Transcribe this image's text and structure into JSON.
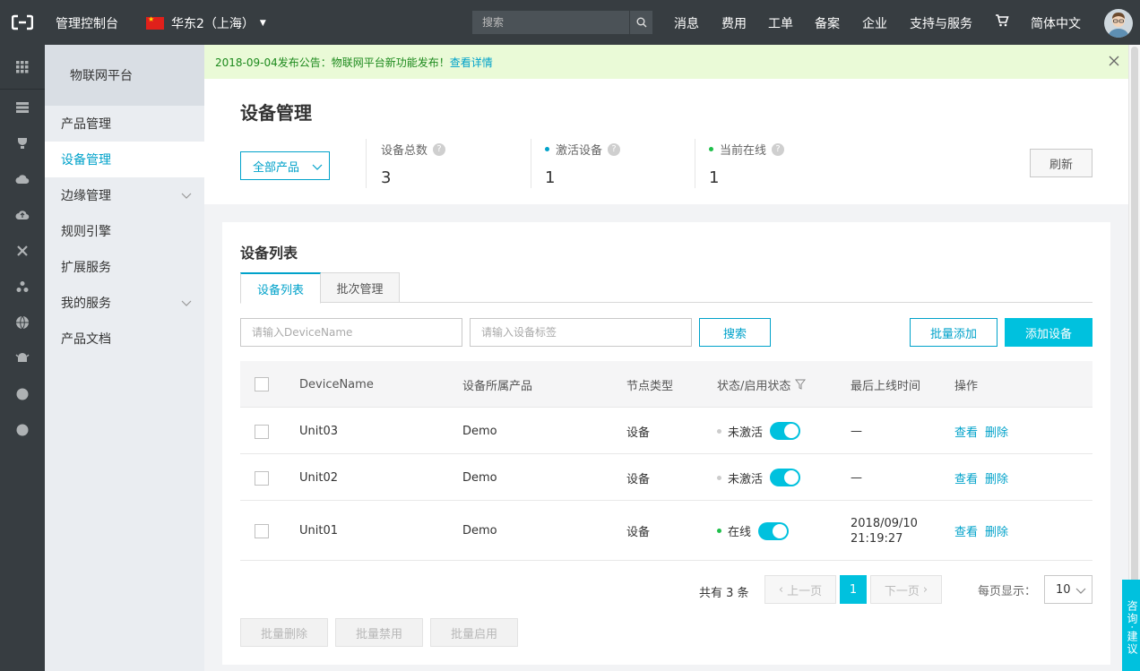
{
  "topbar": {
    "title": "管理控制台",
    "region": "华东2（上海）",
    "search_placeholder": "搜索",
    "nav": [
      "消息",
      "费用",
      "工单",
      "备案",
      "企业",
      "支持与服务"
    ],
    "language": "简体中文"
  },
  "sidebar": {
    "header": "物联网平台",
    "items": [
      {
        "label": "产品管理"
      },
      {
        "label": "设备管理"
      },
      {
        "label": "边缘管理"
      },
      {
        "label": "规则引擎"
      },
      {
        "label": "扩展服务"
      },
      {
        "label": "我的服务"
      },
      {
        "label": "产品文档"
      }
    ]
  },
  "notice": {
    "text": "2018-09-04发布公告：物联网平台新功能发布！",
    "link": "查看详情"
  },
  "page": {
    "title": "设备管理",
    "product_filter": "全部产品",
    "stats": [
      {
        "label": "设备总数",
        "value": "3"
      },
      {
        "label": "激活设备",
        "value": "1"
      },
      {
        "label": "当前在线",
        "value": "1"
      }
    ],
    "refresh": "刷新"
  },
  "list": {
    "title": "设备列表",
    "tabs": [
      "设备列表",
      "批次管理"
    ],
    "name_placeholder": "请输入DeviceName",
    "tag_placeholder": "请输入设备标签",
    "search_btn": "搜索",
    "bulk_add": "批量添加",
    "add_device": "添加设备",
    "columns": [
      "DeviceName",
      "设备所属产品",
      "节点类型",
      "状态/启用状态",
      "最后上线时间",
      "操作"
    ],
    "rows": [
      {
        "name": "Unit03",
        "product": "Demo",
        "node": "设备",
        "status": "未激活",
        "last": "—",
        "view": "查看",
        "del": "删除"
      },
      {
        "name": "Unit02",
        "product": "Demo",
        "node": "设备",
        "status": "未激活",
        "last": "—",
        "view": "查看",
        "del": "删除"
      },
      {
        "name": "Unit01",
        "product": "Demo",
        "node": "设备",
        "status": "在线",
        "last_date": "2018/09/10",
        "last_time": "21:19:27",
        "view": "查看",
        "del": "删除"
      }
    ],
    "pager": {
      "total": "共有 3 条",
      "prev": "上一页",
      "page": "1",
      "next": "下一页",
      "per_label": "每页显示：",
      "per_value": "10"
    },
    "bulk_buttons": [
      "批量删除",
      "批量禁用",
      "批量启用"
    ]
  },
  "consult": "咨询·建议",
  "colors": {
    "accent": "#00c1de",
    "link": "#00a2ca",
    "online": "#1fbf4b",
    "inactive": "#cccccc"
  }
}
